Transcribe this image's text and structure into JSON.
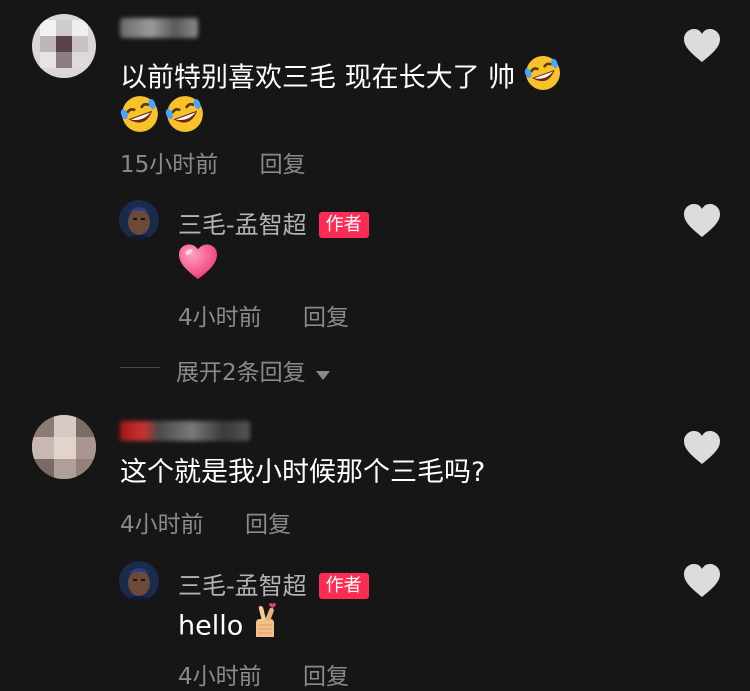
{
  "comments": [
    {
      "text_line1": "以前特别喜欢三毛 现在长大了 帅",
      "time": "15小时前",
      "reply_label": "回复",
      "reply": {
        "author": "三毛-孟智超",
        "badge": "作者",
        "time": "4小时前",
        "reply_label": "回复"
      },
      "expand_label": "展开2条回复"
    },
    {
      "text_line1": "这个就是我小时候那个三毛吗?",
      "time": "4小时前",
      "reply_label": "回复",
      "reply": {
        "author": "三毛-孟智超",
        "badge": "作者",
        "text": "hello",
        "time": "4小时前",
        "reply_label": "回复"
      }
    }
  ],
  "icons": {
    "like": "heart-icon",
    "expand": "caret-down-icon",
    "emoji_laugh": "rolling-on-floor-laughing-emoji",
    "emoji_heart": "pink-heart-emoji",
    "emoji_finger_heart": "finger-heart-emoji"
  },
  "colors": {
    "background": "#161616",
    "badge": "#fe2c55",
    "meta": "#8a8a8a",
    "heart_icon": "#dcdcdc"
  }
}
